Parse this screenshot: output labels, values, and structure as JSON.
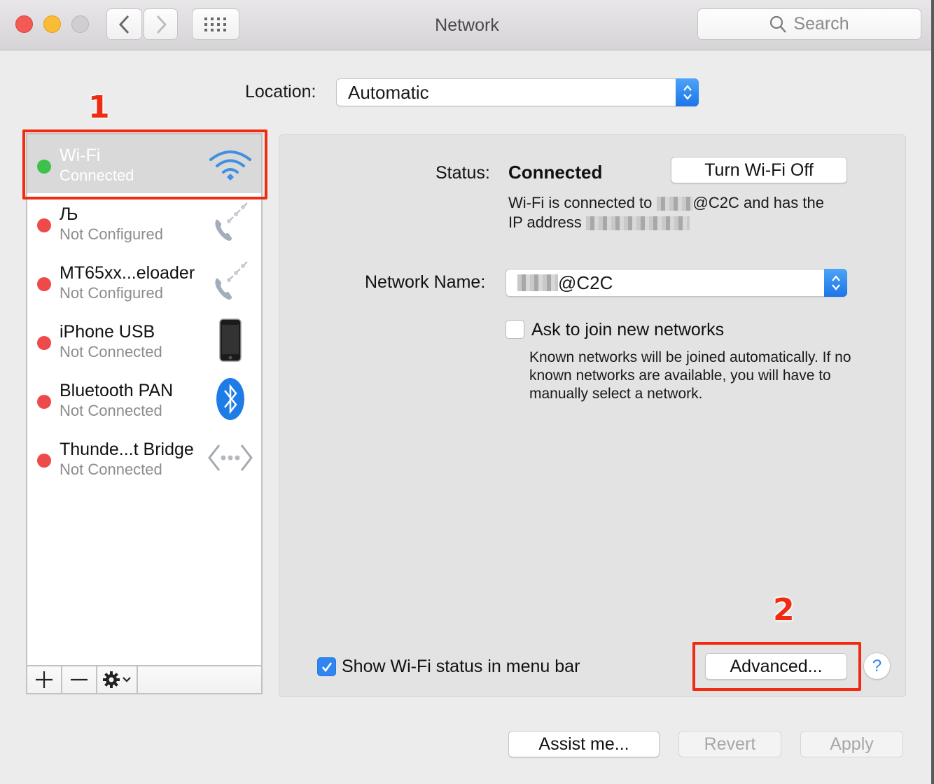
{
  "window": {
    "title": "Network",
    "search_placeholder": "Search"
  },
  "location": {
    "label": "Location:",
    "value": "Automatic"
  },
  "services": [
    {
      "name": "Wi-Fi",
      "state": "Connected",
      "status_color": "#3ec14a",
      "icon": "wifi-icon",
      "selected": true
    },
    {
      "name": "Љ",
      "state": "Not Configured",
      "status_color": "#ef4a4a",
      "icon": "modem-phone-icon",
      "selected": false
    },
    {
      "name": "MT65xx...eloader",
      "state": "Not Configured",
      "status_color": "#ef4a4a",
      "icon": "modem-phone-icon",
      "selected": false
    },
    {
      "name": "iPhone USB",
      "state": "Not Connected",
      "status_color": "#ef4a4a",
      "icon": "iphone-icon",
      "selected": false
    },
    {
      "name": "Bluetooth PAN",
      "state": "Not Connected",
      "status_color": "#ef4a4a",
      "icon": "bluetooth-icon",
      "selected": false
    },
    {
      "name": "Thunde...t Bridge",
      "state": "Not Connected",
      "status_color": "#ef4a4a",
      "icon": "bridge-icon",
      "selected": false
    }
  ],
  "sidebar_toolbar": {
    "add": "+",
    "remove": "—"
  },
  "detail": {
    "status_label": "Status:",
    "status_value": "Connected",
    "turn_off_button": "Turn Wi-Fi Off",
    "desc_prefix": "Wi-Fi is connected to",
    "desc_network_suffix": "@C2C and has the",
    "desc_ip_prefix": "IP address",
    "network_name_label": "Network Name:",
    "network_name_suffix": "@C2C",
    "ask_join_label": "Ask to join new networks",
    "ask_join_checked": false,
    "ask_join_desc": "Known networks will be joined automatically. If no known networks are available, you will have to manually select a network.",
    "show_status_label": "Show Wi-Fi status in menu bar",
    "show_status_checked": true,
    "advanced_button": "Advanced...",
    "help_button": "?"
  },
  "footer": {
    "assist": "Assist me...",
    "revert": "Revert",
    "apply": "Apply"
  },
  "annotations": {
    "one": "1",
    "two": "2",
    "color": "#f02b12"
  }
}
